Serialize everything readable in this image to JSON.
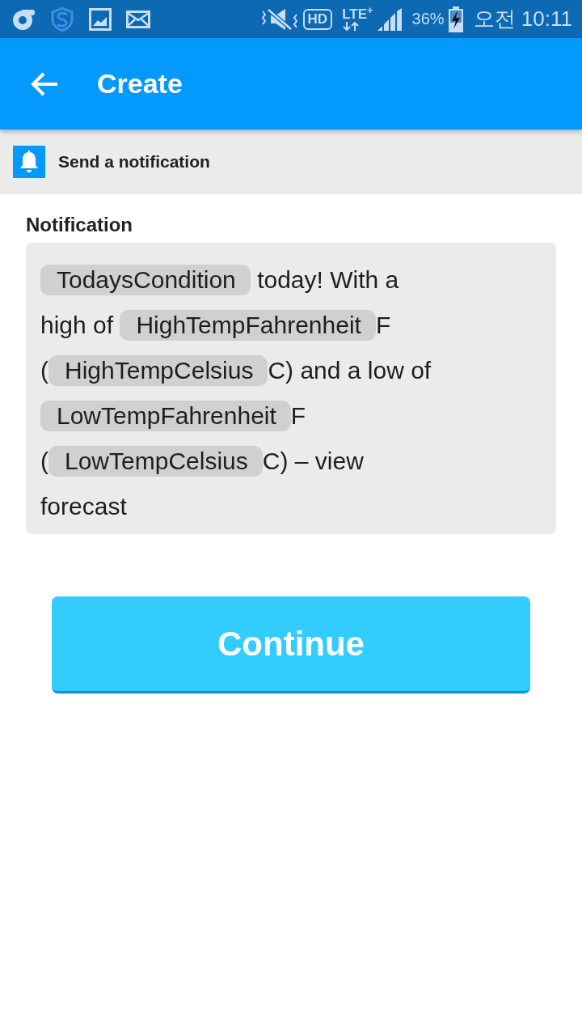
{
  "status_bar": {
    "hd": "HD",
    "network": "LTE$^{+}$",
    "battery": "36%",
    "time": "오전 10:11"
  },
  "app_bar": {
    "title": "Create"
  },
  "action": {
    "label": "Send a notification"
  },
  "notification": {
    "label": "Notification",
    "lines": [
      [
        {
          "kind": "ingredient",
          "text": "TodaysCondition"
        },
        {
          "kind": "text",
          "text": " today! With a"
        }
      ],
      [
        {
          "kind": "text",
          "text": "high of "
        },
        {
          "kind": "ingredient",
          "text": "HighTempFahrenheit"
        },
        {
          "kind": "text",
          "text": "F"
        }
      ],
      [
        {
          "kind": "text",
          "text": "("
        },
        {
          "kind": "ingredient",
          "text": "HighTempCelsius"
        },
        {
          "kind": "text",
          "text": "C) and a low of"
        }
      ],
      [
        {
          "kind": "ingredient",
          "text": "LowTempFahrenheit"
        },
        {
          "kind": "text",
          "text": "F"
        }
      ],
      [
        {
          "kind": "text",
          "text": "("
        },
        {
          "kind": "ingredient",
          "text": "LowTempCelsius"
        },
        {
          "kind": "text",
          "text": "C) – view"
        }
      ],
      [
        {
          "kind": "text",
          "text": "forecast"
        }
      ]
    ]
  },
  "continue_button": {
    "label": "Continue"
  }
}
